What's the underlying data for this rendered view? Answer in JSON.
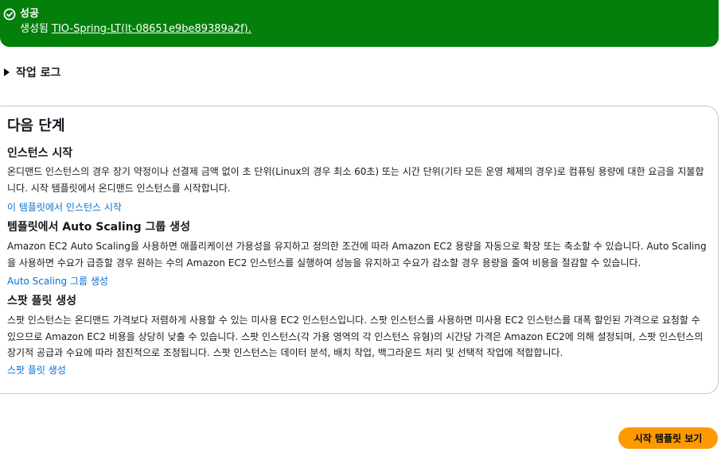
{
  "flash": {
    "icon": "success-check-icon",
    "color": "#037f0c",
    "title": "성공",
    "message_prefix": "생성됨 ",
    "link_text": "TIO-Spring-LT(lt-08651e9be89389a2f)."
  },
  "action_log": {
    "icon": "caret-right-icon",
    "label": "작업 로그"
  },
  "next_steps": {
    "title": "다음 단계",
    "sections": [
      {
        "title": "인스턴스 시작",
        "description": "온디맨드 인스턴스의 경우 장기 약정이나 선결제 금액 없이 초 단위(Linux의 경우 최소 60초) 또는 시간 단위(기타 모든 운영 체제의 경우)로 컴퓨팅 용량에 대한 요금을 지불합니다. 시작 템플릿에서 온디맨드 인스턴스를 시작합니다.",
        "link": "이 템플릿에서 인스턴스 시작"
      },
      {
        "title": "템플릿에서 Auto Scaling 그룹 생성",
        "description": "Amazon EC2 Auto Scaling을 사용하면 애플리케이션 가용성을 유지하고 정의한 조건에 따라 Amazon EC2 용량을 자동으로 확장 또는 축소할 수 있습니다. Auto Scaling을 사용하면 수요가 급증할 경우 원하는 수의 Amazon EC2 인스턴스를 실행하여 성능을 유지하고 수요가 감소할 경우 용량을 줄여 비용을 절감할 수 있습니다.",
        "link": "Auto Scaling 그룹 생성"
      },
      {
        "title": "스팟 플릿 생성",
        "description": "스팟 인스턴스는 온디맨드 가격보다 저렴하게 사용할 수 있는 미사용 EC2 인스턴스입니다. 스팟 인스턴스를 사용하면 미사용 EC2 인스턴스를 대폭 할인된 가격으로 요청할 수 있으므로 Amazon EC2 비용을 상당히 낮출 수 있습니다. 스팟 인스턴스(각 가용 영역의 각 인스턴스 유형)의 시간당 가격은 Amazon EC2에 의해 설정되며, 스팟 인스턴스의 장기적 공급과 수요에 따라 점진적으로 조정됩니다. 스팟 인스턴스는 데이터 분석, 배치 작업, 백그라운드 처리 및 선택적 작업에 적합합니다.",
        "link": "스팟 플릿 생성"
      }
    ]
  },
  "primary_button": {
    "label": "시작 템플릿 보기",
    "color": "#ff9900"
  }
}
